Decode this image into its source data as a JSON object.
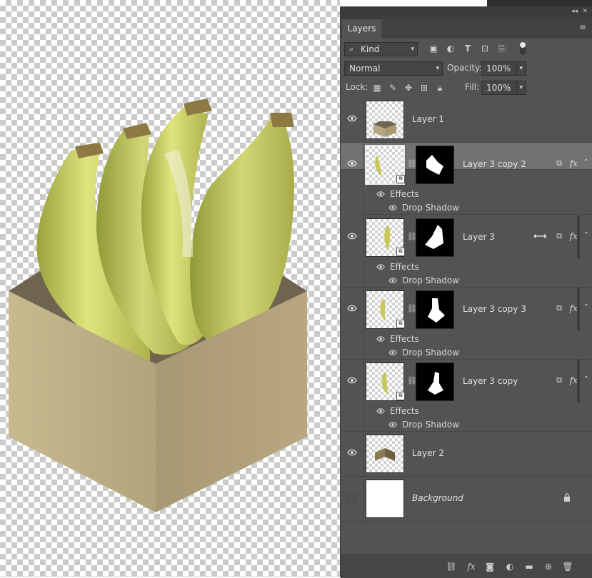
{
  "panel": {
    "tab_label": "Layers",
    "filter_kind": "Kind",
    "blend_mode": "Normal",
    "opacity_label": "Opacity:",
    "opacity_value": "100%",
    "lock_label": "Lock:",
    "fill_label": "Fill:",
    "fill_value": "100%"
  },
  "layers": [
    {
      "name": "Layer 1",
      "visible": true,
      "selected": false,
      "effects": false
    },
    {
      "name": "Layer 3 copy 2",
      "visible": true,
      "selected": true,
      "effects": true
    },
    {
      "name": "Layer 3",
      "visible": true,
      "selected": false,
      "effects": true
    },
    {
      "name": "Layer 3 copy 3",
      "visible": true,
      "selected": false,
      "effects": true
    },
    {
      "name": "Layer 3 copy",
      "visible": true,
      "selected": false,
      "effects": true
    },
    {
      "name": "Layer 2",
      "visible": true,
      "selected": false,
      "effects": false
    },
    {
      "name": "Background",
      "visible": false,
      "selected": false,
      "effects": false,
      "locked": true
    }
  ],
  "effects_labels": {
    "effects": "Effects",
    "drop_shadow": "Drop Shadow"
  },
  "icons": {
    "filter": [
      "image-filter-icon",
      "adjustment-filter-icon",
      "type-filter-icon",
      "shape-filter-icon",
      "smart-object-filter-icon",
      "filter-toggle-icon"
    ],
    "lock": [
      "lock-transparent-pixels-icon",
      "lock-image-pixels-icon",
      "lock-position-icon",
      "lock-artboard-icon",
      "lock-all-icon"
    ],
    "bottom": [
      "link-layers-icon",
      "fx-icon",
      "add-mask-icon",
      "adjustment-layer-icon",
      "new-group-icon",
      "new-layer-icon",
      "delete-icon"
    ]
  },
  "colors": {
    "panel_bg": "#535353",
    "selected_row": "#727272",
    "box": "#b5a684",
    "banana": "#c8c85a"
  }
}
